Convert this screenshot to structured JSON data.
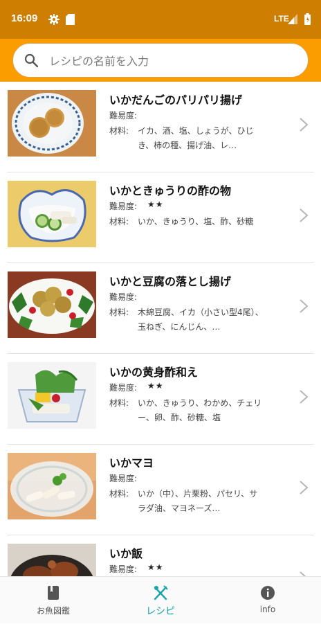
{
  "statusbar": {
    "time": "16:09",
    "network": "LTE"
  },
  "search": {
    "placeholder": "レシピの名前を入力"
  },
  "labels": {
    "difficulty": "難易度:",
    "materials": "材料:"
  },
  "recipes": [
    {
      "title": "いかだんごのパリパリ揚げ",
      "stars": "",
      "materials": "イカ、酒、塩、しょうが、ひじき、柿の種、揚げ油、レ…",
      "thumb": "fried-squid-balls"
    },
    {
      "title": "いかときゅうりの酢の物",
      "stars": "★★",
      "materials": "いか、きゅうり、塩、酢、砂糖",
      "thumb": "squid-cucumber-vinegar"
    },
    {
      "title": "いかと豆腐の落とし揚げ",
      "stars": "",
      "materials": "木綿豆腐、イカ（小さい型4尾）、玉ねぎ、にんじん、…",
      "thumb": "squid-tofu-fritters"
    },
    {
      "title": "いかの黄身酢和え",
      "stars": "★★",
      "materials": "いか、きゅうり、わかめ、チェリー、卵、酢、砂糖、塩",
      "thumb": "squid-yolk-vinegar"
    },
    {
      "title": "いかマヨ",
      "stars": "",
      "materials": "いか（中）、片栗粉、パセリ、サラダ油、マヨネーズ…",
      "thumb": "squid-mayo"
    },
    {
      "title": "いか飯",
      "stars": "★★",
      "materials": "",
      "thumb": "squid-rice"
    }
  ],
  "nav": {
    "items": [
      {
        "label": "お魚図鑑",
        "icon": "book-icon"
      },
      {
        "label": "レシピ",
        "icon": "utensils-icon",
        "active": true
      },
      {
        "label": "info",
        "icon": "info-icon"
      }
    ]
  },
  "colors": {
    "statusbar": "#ce7f02",
    "searchbar": "#fb9c00",
    "nav_active": "#1aa3a8"
  }
}
